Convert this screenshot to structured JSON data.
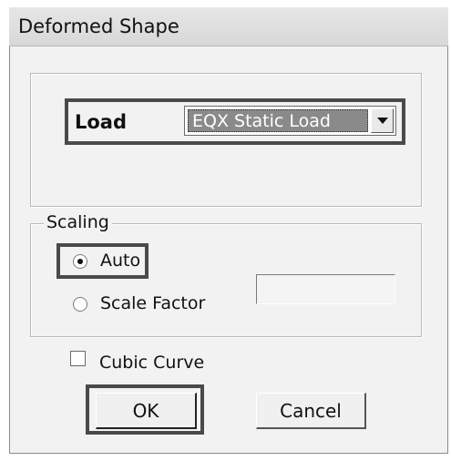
{
  "window": {
    "title": "Deformed Shape"
  },
  "load": {
    "label": "Load",
    "selected_value": "EQX Static Load"
  },
  "scaling": {
    "caption": "Scaling",
    "options": [
      {
        "label": "Auto",
        "selected": true
      },
      {
        "label": "Scale Factor",
        "selected": false
      }
    ],
    "scale_factor_value": ""
  },
  "cubic_curve": {
    "label": "Cubic Curve",
    "checked": false
  },
  "buttons": {
    "ok": "OK",
    "cancel": "Cancel"
  },
  "icons": {
    "combo_arrow": "chevron-down-icon"
  }
}
